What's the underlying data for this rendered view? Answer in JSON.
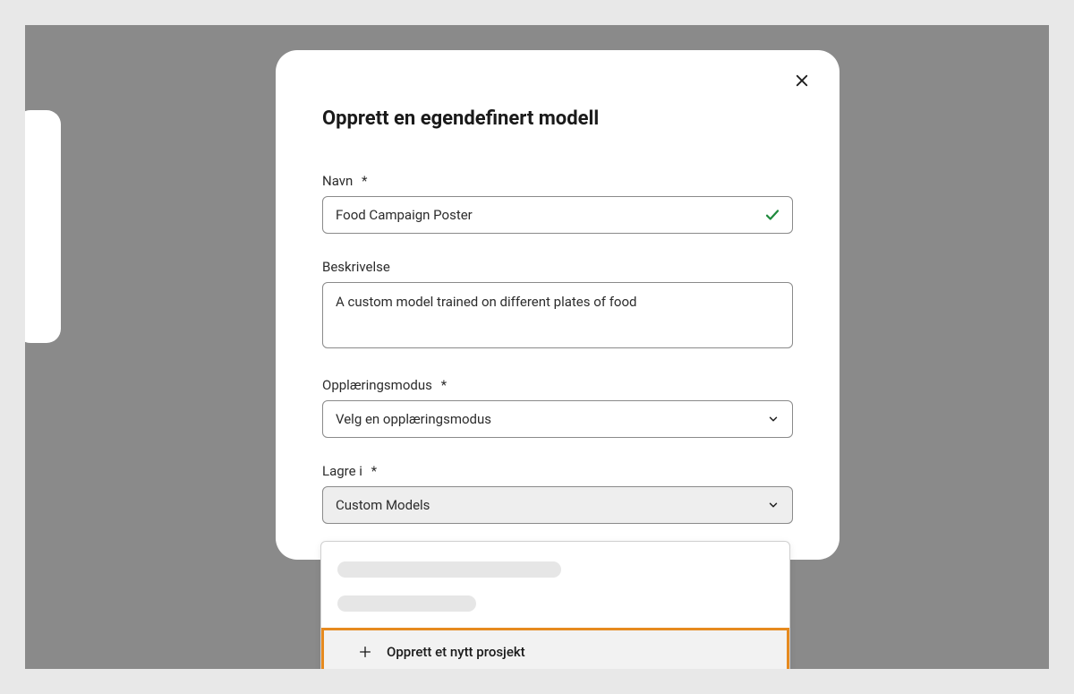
{
  "modal": {
    "title": "Opprett en egendefinert modell",
    "required_mark": "*",
    "fields": {
      "name": {
        "label": "Navn",
        "value": "Food Campaign Poster",
        "valid": true
      },
      "description": {
        "label": "Beskrivelse",
        "value": "A custom model trained on different plates of food"
      },
      "training_mode": {
        "label": "Opplæringsmodus",
        "placeholder": "Velg en opplæringsmodus"
      },
      "save_in": {
        "label": "Lagre i",
        "selected": "Custom Models"
      }
    },
    "dropdown": {
      "create_project_label": "Opprett et nytt prosjekt"
    }
  }
}
